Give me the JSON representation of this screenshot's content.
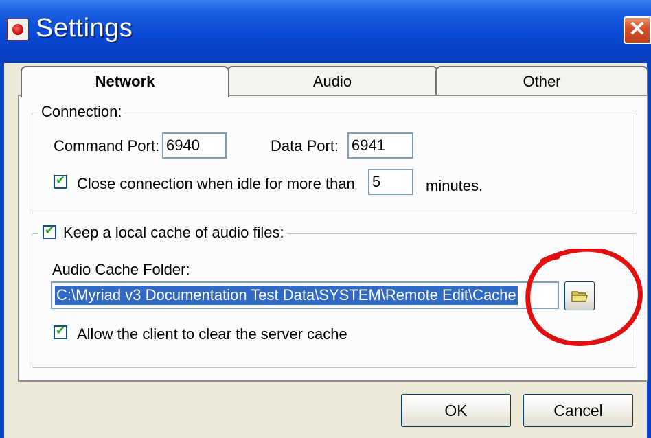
{
  "window": {
    "title": "Settings"
  },
  "tabs": [
    "Network",
    "Audio",
    "Other"
  ],
  "connection": {
    "legend": "Connection:",
    "command_port_label": "Command Port:",
    "command_port_value": "6940",
    "data_port_label": "Data Port:",
    "data_port_value": "6941",
    "idle_label": "Close connection when idle for more than",
    "idle_value": "5",
    "idle_unit": "minutes.",
    "idle_checked": true
  },
  "cache": {
    "legend": "Keep a local cache of audio files:",
    "legend_checked": true,
    "folder_label": "Audio Cache Folder:",
    "folder_value": "C:\\Myriad v3 Documentation Test Data\\SYSTEM\\Remote Edit\\Cache",
    "allow_clear_label": "Allow the client to clear the server cache",
    "allow_clear_checked": true
  },
  "buttons": {
    "ok": "OK",
    "cancel": "Cancel"
  },
  "icons": {
    "title": "app-icon",
    "close": "close-icon",
    "browse": "folder-icon"
  },
  "colors": {
    "titlebar": "#0a49d6",
    "close": "#d5522b",
    "selection": "#316ac5",
    "annotation": "#e01010"
  }
}
